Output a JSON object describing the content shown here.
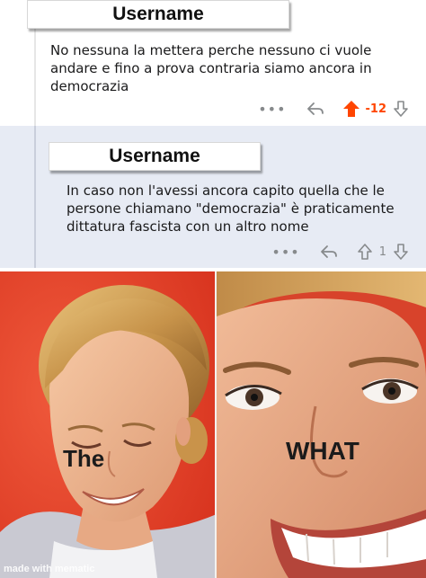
{
  "comments": [
    {
      "username": "Username",
      "text": "No nessuna la mettera perche nessuno ci vuole\nandare e fino a prova contraria siamo ancora in\ndemocrazia",
      "score": "-12",
      "vote_state": "upvoted"
    },
    {
      "username": "Username",
      "text": "In caso non l'avessi  ancora capito quella che le\npersone chiamano \"democrazia\" è praticamente\ndittatura fascista con un altro nome",
      "score": "1",
      "vote_state": "none"
    }
  ],
  "icons": {
    "more": "more-options-icon",
    "reply": "reply-icon",
    "upvote": "upvote-arrow-icon",
    "downvote": "downvote-arrow-icon"
  },
  "colors": {
    "upvote_active": "#ff4500",
    "icon_gray": "#878a8c",
    "highlight_bg": "#e7ebf4",
    "meme_red": "#e8402e"
  },
  "meme": {
    "left_caption": "The",
    "right_caption": "WHAT",
    "watermark": "made with mematic"
  }
}
